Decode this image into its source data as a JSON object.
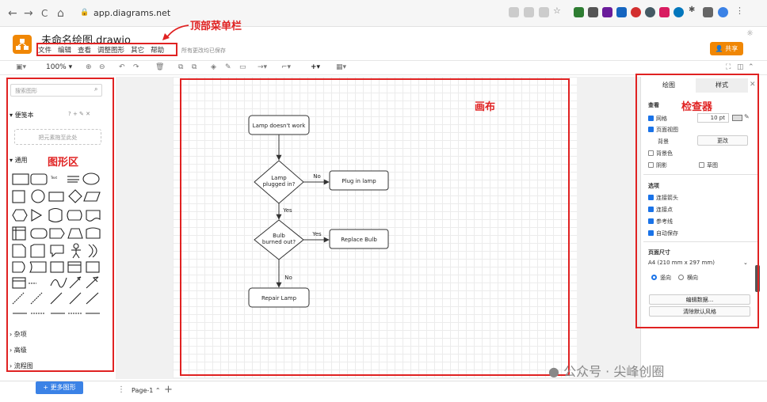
{
  "browser": {
    "url": "app.diagrams.net",
    "back": "←",
    "forward": "→",
    "reload": "C",
    "home": "⌂"
  },
  "app": {
    "title": "未命名绘图.drawio",
    "saved_status": "所有更改均已保存",
    "share_label": "共享"
  },
  "menu": [
    "文件",
    "编辑",
    "查看",
    "调整图形",
    "其它",
    "帮助"
  ],
  "toolbar": {
    "zoom": "100%"
  },
  "left_panel": {
    "search_placeholder": "搜索图形",
    "scratchpad": "便笺本",
    "scratchpad_actions": "? + ✎ ✕",
    "drop_hint": "把元素拖至此处",
    "general": "通用",
    "more_sections": [
      "杂项",
      "高级",
      "流程图"
    ],
    "more_shapes_button": "+ 更多图形"
  },
  "page_tab": "Page-1",
  "inspector": {
    "tabs": [
      "绘图",
      "样式"
    ],
    "view_title": "查看",
    "grid_label": "网格",
    "grid_size": "10 pt",
    "page_view_label": "页面视图",
    "background_label": "背景",
    "change_button": "更改",
    "bg_color_label": "背景色",
    "shadow_label": "阴影",
    "sketch_label": "草图",
    "options_title": "选项",
    "options": [
      "连接箭头",
      "连接点",
      "参考线",
      "自动保存"
    ],
    "page_size_title": "页面尺寸",
    "page_size_value": "A4 (210 mm x 297 mm)",
    "portrait_label": "竖向",
    "landscape_label": "横向",
    "edit_data_button": "编辑数据...",
    "clear_style_button": "清除默认风格"
  },
  "flowchart": {
    "start": "Lamp doesn't work",
    "decision1": [
      "Lamp",
      "plugged in?"
    ],
    "action1": "Plug in lamp",
    "decision2": [
      "Bulb",
      "burned out?"
    ],
    "action2": "Replace Bulb",
    "end": "Repair Lamp",
    "no": "No",
    "yes": "Yes"
  },
  "annotations": {
    "menu_bar": "顶部菜单栏",
    "canvas": "画布",
    "inspector": "检查器",
    "shapes": "图形区"
  },
  "watermark": "公众号 · 尖峰创圈",
  "colors": {
    "accent": "#f08705",
    "annotation": "#e02222",
    "link": "#3b82e6"
  }
}
